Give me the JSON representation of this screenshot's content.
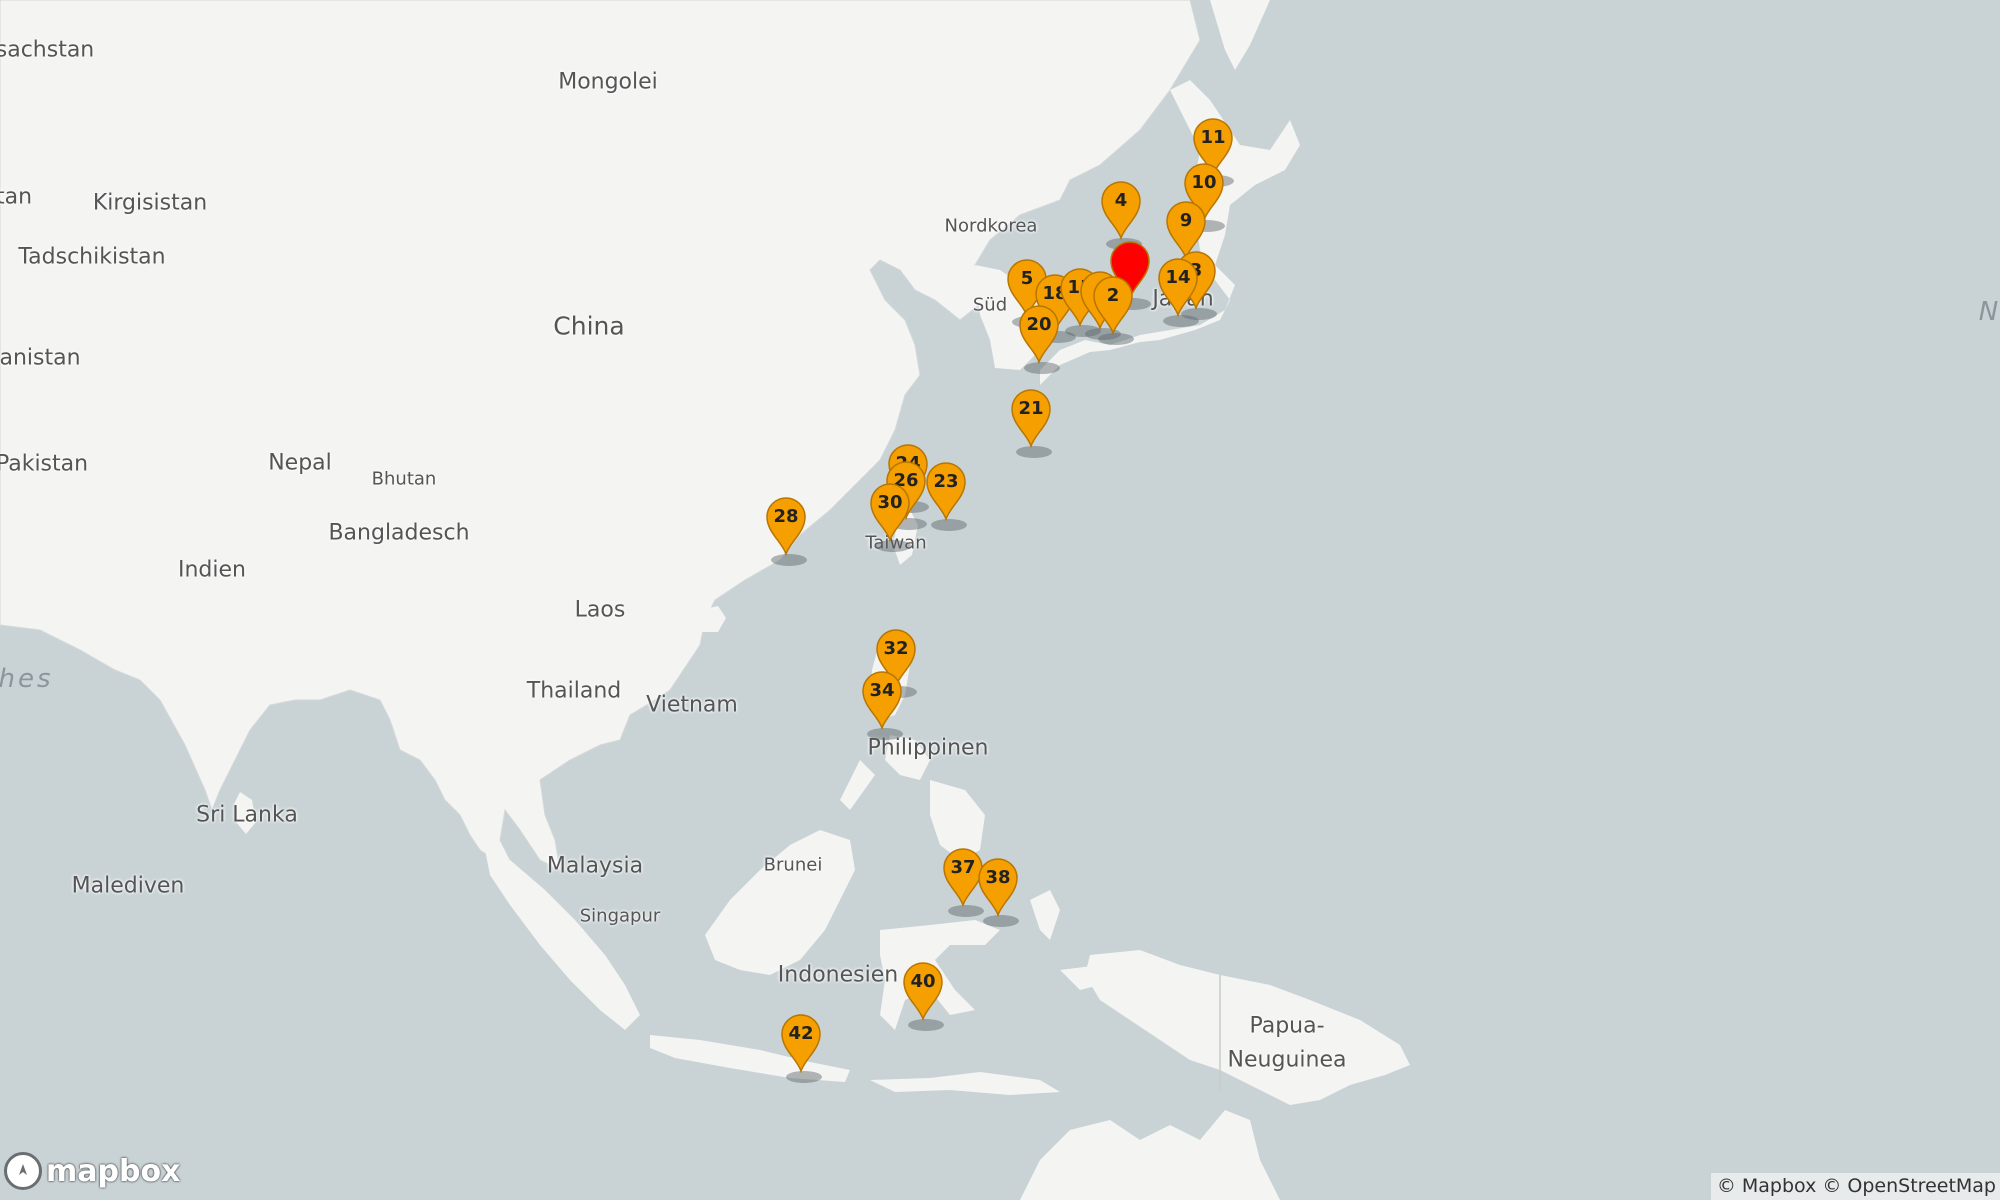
{
  "map": {
    "country_labels": [
      {
        "text": "sachstan",
        "size": "md"
      },
      {
        "text": "Mongolei",
        "size": "md"
      },
      {
        "text": "tan",
        "size": "md"
      },
      {
        "text": "Kirgisistan",
        "size": "md"
      },
      {
        "text": "Tadschikistan",
        "size": "md"
      },
      {
        "text": "Nordkorea",
        "size": "sm"
      },
      {
        "text": "Süd",
        "size": "sm"
      },
      {
        "text": "Japan",
        "size": "md"
      },
      {
        "text": "China",
        "size": "lg"
      },
      {
        "text": "anistan",
        "size": "md"
      },
      {
        "text": "Pakistan",
        "size": "md"
      },
      {
        "text": "Nepal",
        "size": "md"
      },
      {
        "text": "Bhutan",
        "size": "sm"
      },
      {
        "text": "Bangladesch",
        "size": "md"
      },
      {
        "text": "Indien",
        "size": "md"
      },
      {
        "text": "Taiwan",
        "size": "sm"
      },
      {
        "text": "Laos",
        "size": "md"
      },
      {
        "text": "Thailand",
        "size": "md"
      },
      {
        "text": "Vietnam",
        "size": "md"
      },
      {
        "text": "Philippinen",
        "size": "md"
      },
      {
        "text": "Sri Lanka",
        "size": "md"
      },
      {
        "text": "Malediven",
        "size": "md"
      },
      {
        "text": "Malaysia",
        "size": "md"
      },
      {
        "text": "Brunei",
        "size": "sm"
      },
      {
        "text": "Singapur",
        "size": "sm"
      },
      {
        "text": "Indonesien",
        "size": "md"
      },
      {
        "text": "Papua-",
        "size": "md"
      },
      {
        "text": "Neuguinea",
        "size": "md"
      }
    ],
    "ocean_labels": [
      {
        "text": "hes"
      },
      {
        "text": "N"
      }
    ],
    "markers": [
      {
        "label": "11",
        "color": "#f5a000"
      },
      {
        "label": "10",
        "color": "#f5a000"
      },
      {
        "label": "4",
        "color": "#f5a000"
      },
      {
        "label": "9",
        "color": "#f5a000"
      },
      {
        "label": "",
        "color": "#ff0000"
      },
      {
        "label": "5",
        "color": "#f5a000"
      },
      {
        "label": "18",
        "color": "#f5a000"
      },
      {
        "label": "15",
        "color": "#f5a000"
      },
      {
        "label": "",
        "color": "#f5a000"
      },
      {
        "label": "2",
        "color": "#f5a000"
      },
      {
        "label": "3",
        "color": "#f5a000"
      },
      {
        "label": "14",
        "color": "#f5a000"
      },
      {
        "label": "20",
        "color": "#f5a000"
      },
      {
        "label": "21",
        "color": "#f5a000"
      },
      {
        "label": "24",
        "color": "#f5a000"
      },
      {
        "label": "26",
        "color": "#f5a000"
      },
      {
        "label": "23",
        "color": "#f5a000"
      },
      {
        "label": "30",
        "color": "#f5a000"
      },
      {
        "label": "28",
        "color": "#f5a000"
      },
      {
        "label": "32",
        "color": "#f5a000"
      },
      {
        "label": "34",
        "color": "#f5a000"
      },
      {
        "label": "37",
        "color": "#f5a000"
      },
      {
        "label": "38",
        "color": "#f5a000"
      },
      {
        "label": "40",
        "color": "#f5a000"
      },
      {
        "label": "42",
        "color": "#f5a000"
      }
    ]
  },
  "branding": {
    "logo_text": "mapbox",
    "logo_icon": "mapbox-compass-icon"
  },
  "attribution": {
    "text": "© Mapbox © OpenStreetMap"
  },
  "colors": {
    "water": "#c9d3d6",
    "land": "#f4f4f3",
    "marker": "#f5a000",
    "marker_highlight": "#ff0000"
  }
}
